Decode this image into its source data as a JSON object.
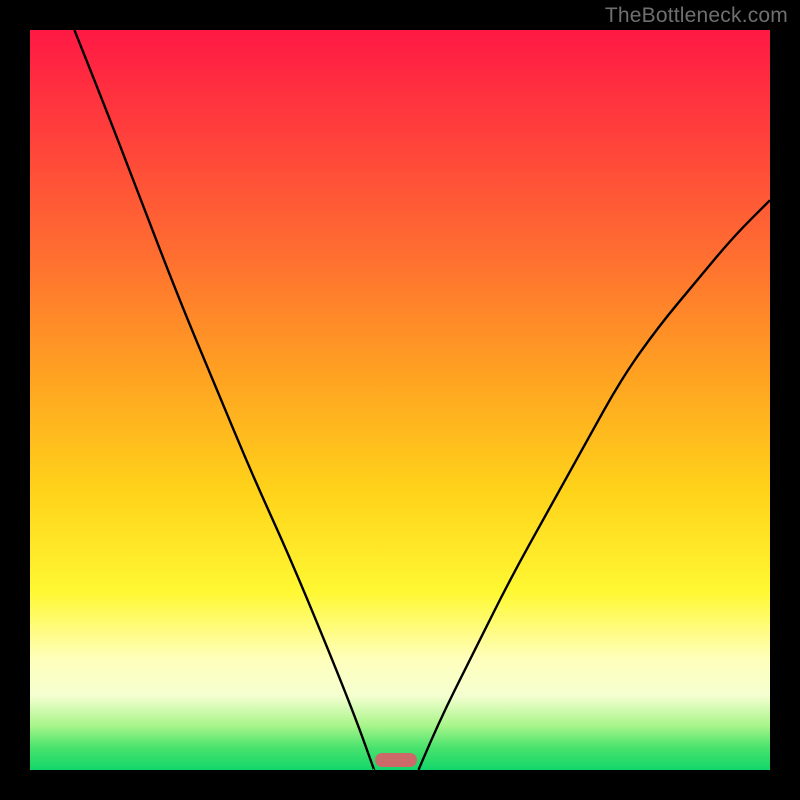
{
  "watermark": "TheBottleneck.com",
  "chart_data": {
    "type": "line",
    "title": "",
    "xlabel": "",
    "ylabel": "",
    "xlim": [
      0,
      100
    ],
    "ylim": [
      0,
      100
    ],
    "grid": false,
    "legend": false,
    "series": [
      {
        "name": "left-curve",
        "x": [
          6,
          10,
          15,
          20,
          25,
          30,
          35,
          40,
          44,
          46.5
        ],
        "values": [
          100,
          90,
          77,
          64,
          52,
          40,
          29,
          17,
          7,
          0
        ]
      },
      {
        "name": "right-curve",
        "x": [
          52.5,
          55,
          60,
          65,
          70,
          75,
          80,
          85,
          90,
          95,
          100
        ],
        "values": [
          0,
          6,
          16,
          26,
          35,
          44,
          53,
          60,
          66,
          72,
          77
        ]
      }
    ],
    "annotations": [
      {
        "name": "bottleneck-marker",
        "x_center": 49.5,
        "y": 1.0,
        "color": "#cc6a69"
      }
    ],
    "background_gradient": {
      "direction": "vertical",
      "stops": [
        {
          "pos": 0,
          "color": "#ff1944"
        },
        {
          "pos": 30,
          "color": "#ff6d31"
        },
        {
          "pos": 62,
          "color": "#ffd21a"
        },
        {
          "pos": 85,
          "color": "#ffffbc"
        },
        {
          "pos": 100,
          "color": "#12d669"
        }
      ]
    }
  }
}
